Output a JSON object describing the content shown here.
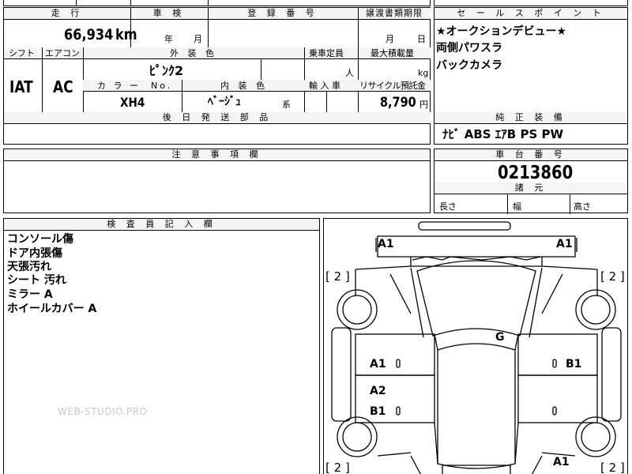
{
  "sheet": {
    "headers": {
      "mileage": "走 行",
      "inspection": "車 検",
      "registration": "登 録 番 号",
      "transfer_deadline": "譲渡書類期限",
      "selling_points": "セ ー ル ス ポ イ ン ト",
      "shift": "シフト",
      "aircon": "エアコン",
      "exterior_color": "外 装 色",
      "capacity": "乗車定員",
      "max_load": "最大積載量",
      "color_no": "カ ラ ー  No.",
      "interior_color": "内 装 色",
      "import": "輸 入 車",
      "recycle_fee": "リサイクル預託金",
      "later_parts": "後 日 発 送 部 品",
      "factory_equipment": "純 正 装 備",
      "caution": "注 意 事 項 欄",
      "chassis_no": "車 台 番 号",
      "dimensions": "諸 元",
      "inspector_notes": "検 査 員 記 入 欄"
    },
    "values": {
      "mileage": "66,934",
      "mileage_unit": "km",
      "year_unit": "年",
      "month_unit": "月",
      "deadline_month": "月",
      "deadline_day": "日",
      "shift": "IAT",
      "aircon": "AC",
      "exterior_color": "ﾋﾟﾝｸ2",
      "capacity_unit": "人",
      "load_unit": "kg",
      "color_no": "XH4",
      "interior_color": "ﾍﾞｰｼﾞｭ",
      "interior_suffix": "系",
      "recycle_fee": "8,790",
      "yen": "円",
      "equipment": "ﾅﾋﾞ ABS ｴｱB PS PW",
      "chassis_no": "0213860",
      "length": "長さ",
      "width": "幅",
      "height": "高さ"
    },
    "selling_points": [
      "★オークションデビュー★",
      "両側パワスラ",
      "バックカメラ"
    ],
    "inspector_notes": [
      "コンソール傷",
      "ドア内張傷",
      "天張汚れ",
      "シート 汚れ",
      "ミラー A",
      "ホイールカバー A"
    ],
    "watermark": "WEB-STUDIO.PRO"
  },
  "diagram": {
    "labels": {
      "front_left": "A1",
      "front_right": "A1",
      "tire_fl": "[ 2 ]",
      "tire_fr": "[ 2 ]",
      "tire_rl": "[ 2 ]",
      "tire_rr": "[ 2 ]",
      "roof": "G",
      "door_fl": "A1",
      "door_fr": "B1",
      "door_rl_1": "A2",
      "door_rl_2": "B1",
      "rear_right": "A1"
    }
  }
}
